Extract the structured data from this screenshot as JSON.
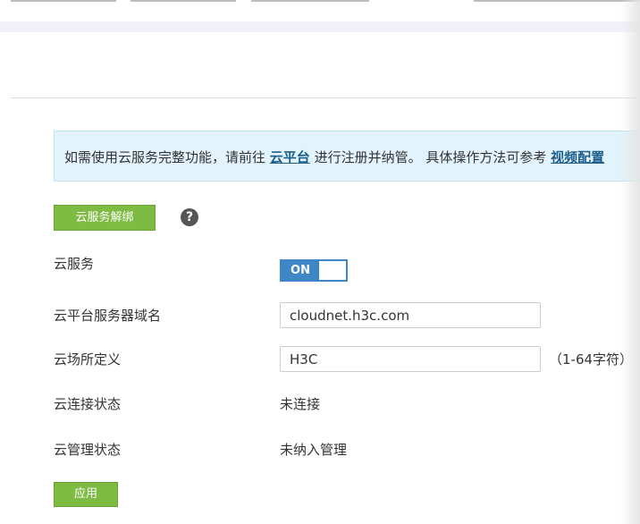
{
  "banner": {
    "text_before": "如需使用云服务完整功能，请前往 ",
    "cloud_platform_link": "云平台",
    "text_middle": " 进行注册并纳管。 具体操作方法可参考 ",
    "guide_link": "视频配置"
  },
  "actions": {
    "unbind_label": "云服务解绑",
    "help_symbol": "?",
    "apply_label": "应用"
  },
  "form": {
    "cloud_service": {
      "label": "云服务",
      "toggle_state": "ON"
    },
    "domain": {
      "label": "云平台服务器域名",
      "value": "cloudnet.h3c.com"
    },
    "site": {
      "label": "云场所定义",
      "value": "H3C",
      "hint": "（1-64字符）"
    },
    "connection_status": {
      "label": "云连接状态",
      "value": "未连接"
    },
    "management_status": {
      "label": "云管理状态",
      "value": "未纳入管理"
    }
  },
  "colors": {
    "accent_green": "#7dbb42",
    "toggle_blue": "#3f86c6",
    "banner_bg": "#e3f3fb",
    "link": "#1c5f8c"
  }
}
